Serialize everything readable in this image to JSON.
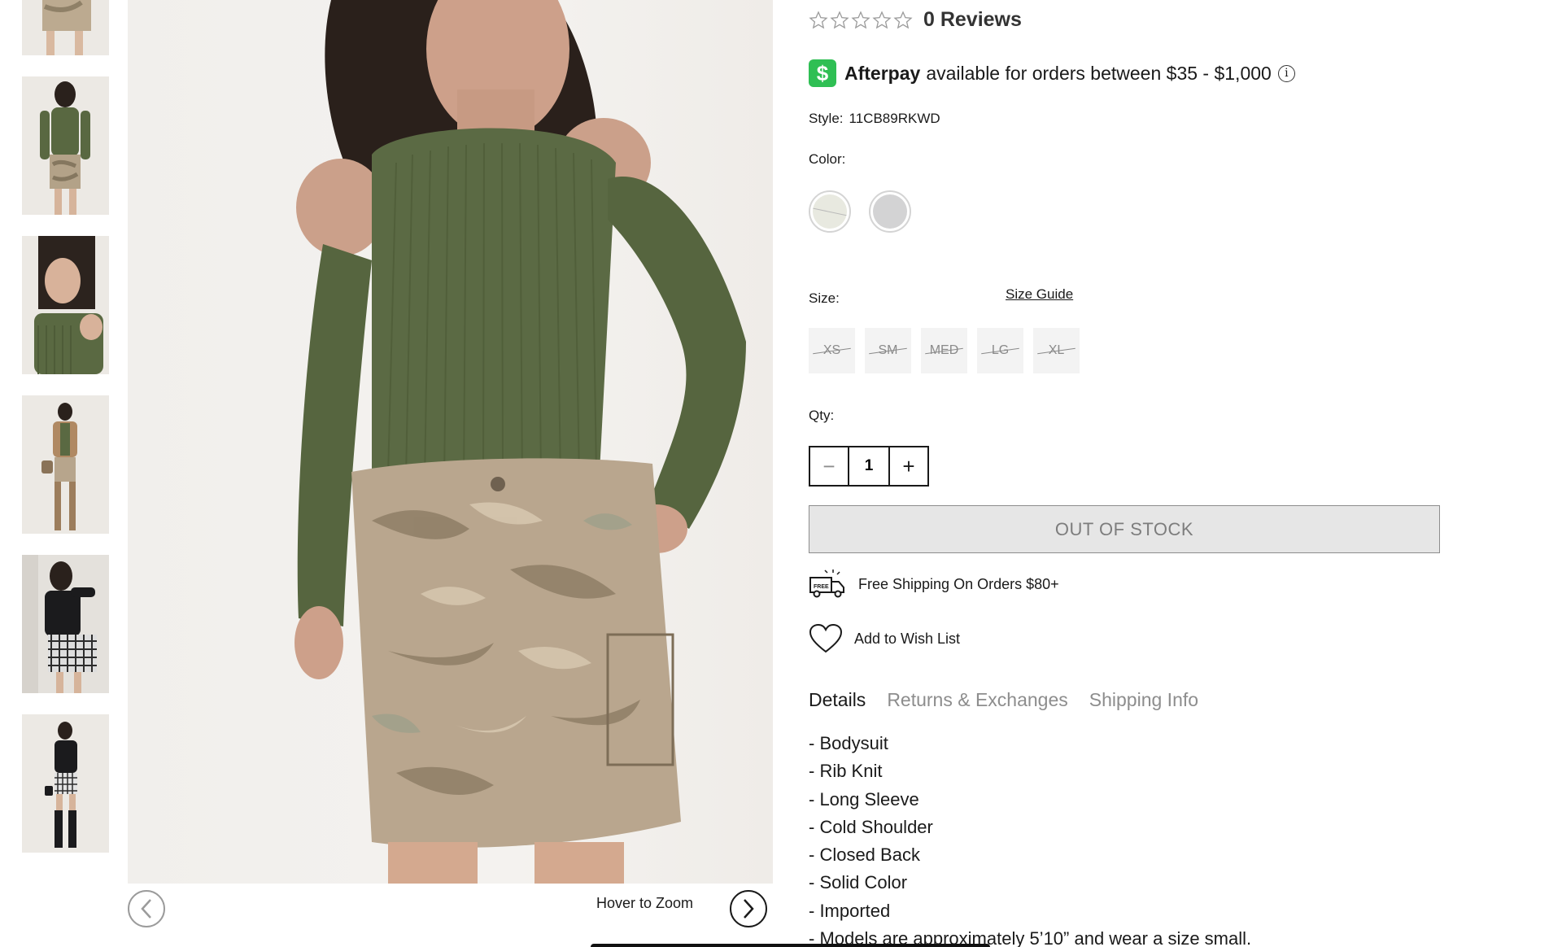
{
  "gallery": {
    "thumbnails": [
      {
        "name": "thumb-camo-skirt-detail",
        "top": 0
      },
      {
        "name": "thumb-back-view"
      },
      {
        "name": "thumb-closeup"
      },
      {
        "name": "thumb-jacket-outfit"
      },
      {
        "name": "thumb-black-top-plaid"
      },
      {
        "name": "thumb-black-outfit-boots"
      }
    ],
    "hover_zoom_label": "Hover to Zoom"
  },
  "product": {
    "rating_stars": 0,
    "reviews_label": "0 Reviews",
    "afterpay": {
      "icon": "$",
      "brand": "Afterpay",
      "text": "available for orders between $35 - $1,000",
      "info_icon": "i"
    },
    "style_label": "Style:",
    "style_value": "11CB89RKWD",
    "color_label": "Color:",
    "colors": [
      {
        "name": "cream",
        "hex": "#e8e9e0"
      },
      {
        "name": "grey",
        "hex": "#d3d3d4"
      }
    ],
    "size_label": "Size:",
    "size_guide": "Size Guide",
    "sizes": [
      "XS",
      "SM",
      "MED",
      "LG",
      "XL"
    ],
    "qty_label": "Qty:",
    "qty_minus": "−",
    "qty_value": "1",
    "qty_plus": "+",
    "stock_button": "OUT OF STOCK",
    "shipping_text": "Free Shipping On Orders $80+",
    "wishlist_text": "Add to Wish List",
    "tabs": [
      "Details",
      "Returns & Exchanges",
      "Shipping Info"
    ],
    "details": [
      "- Bodysuit",
      "- Rib Knit",
      "- Long Sleeve",
      "- Cold Shoulder",
      "- Closed Back",
      "- Solid Color",
      "- Imported",
      "- Models are approximately 5’10” and wear a size small."
    ]
  },
  "colors": {
    "afterpay_green": "#2fbf54",
    "text": "#1a1a1a",
    "muted": "#8d8d8d",
    "top_olive": "#5c6b45",
    "camo_base": "#b9a68e"
  }
}
